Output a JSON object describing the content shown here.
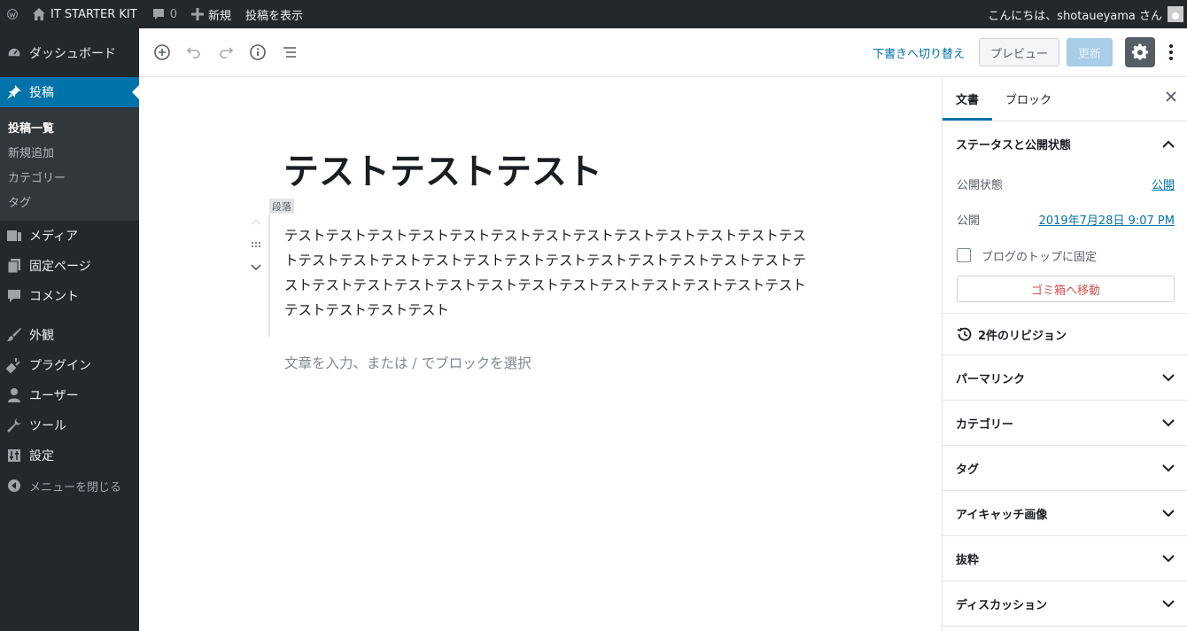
{
  "admin_bar": {
    "site_name": "IT STARTER KIT",
    "comments_count": "0",
    "new_label": "新規",
    "view_post_label": "投稿を表示",
    "greeting": "こんにちは、shotaueyama さん"
  },
  "sidebar": {
    "dashboard": "ダッシュボード",
    "posts": "投稿",
    "posts_sub": [
      "投稿一覧",
      "新規追加",
      "カテゴリー",
      "タグ"
    ],
    "media": "メディア",
    "pages": "固定ページ",
    "comments": "コメント",
    "appearance": "外観",
    "plugins": "プラグイン",
    "users": "ユーザー",
    "tools": "ツール",
    "settings": "設定",
    "collapse": "メニューを閉じる"
  },
  "toolbar": {
    "switch_draft": "下書きへ切り替え",
    "preview": "プレビュー",
    "update": "更新"
  },
  "editor": {
    "title": "テストテストテスト",
    "block_type": "段落",
    "paragraph": "テストテストテストテストテストテストテストテストテストテストテストテストテストテストテストテストテストテストテストテストテストテストテストテストテストテストテストテストテストテストテストテストテストテストテストテストテストテストテストテストテストテスト",
    "placeholder": "文章を入力、または / でブロックを選択"
  },
  "settings_panel": {
    "tab_document": "文書",
    "tab_block": "ブロック",
    "status_title": "ステータスと公開状態",
    "visibility_label": "公開状態",
    "visibility_value": "公開",
    "publish_label": "公開",
    "publish_value": "2019年7月28日 9:07 PM",
    "sticky_label": "ブログのトップに固定",
    "trash_label": "ゴミ箱へ移動",
    "revisions": "2件のリビジョン",
    "panels": [
      "パーマリンク",
      "カテゴリー",
      "タグ",
      "アイキャッチ画像",
      "抜粋",
      "ディスカッション"
    ]
  }
}
